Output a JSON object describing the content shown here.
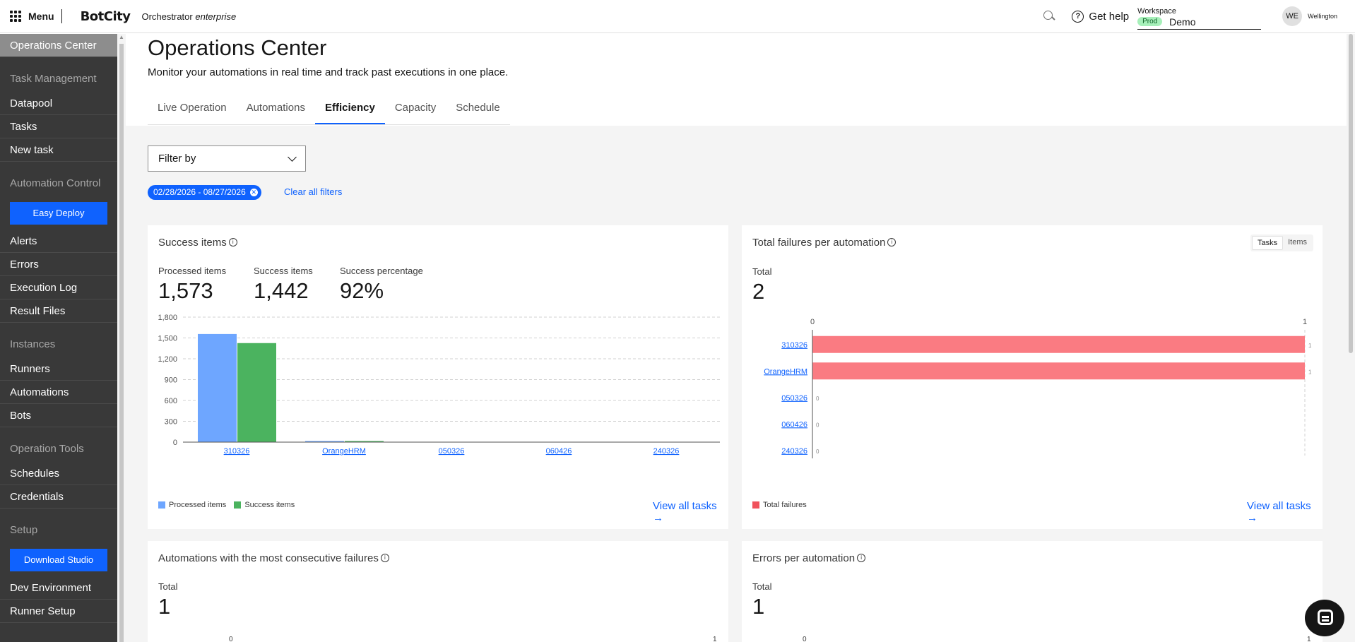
{
  "topbar": {
    "menu_label": "Menu",
    "logo": "BotCity",
    "product_name": "Orchestrator",
    "product_edition": "enterprise",
    "help_label": "Get help",
    "workspace_label": "Workspace",
    "workspace_env": "Prod",
    "workspace_name": "Demo",
    "user_initials": "WE",
    "user_name": "Wellington"
  },
  "sidebar": {
    "active": "Operations Center",
    "groups": [
      {
        "title": "Task Management",
        "items": [
          "Datapool",
          "Tasks",
          "New task"
        ]
      },
      {
        "title": "Automation Control",
        "button": "Easy Deploy",
        "items": [
          "Alerts",
          "Errors",
          "Execution Log",
          "Result Files"
        ]
      },
      {
        "title": "Instances",
        "items": [
          "Runners",
          "Automations",
          "Bots"
        ]
      },
      {
        "title": "Operation Tools",
        "items": [
          "Schedules",
          "Credentials"
        ]
      },
      {
        "title": "Setup",
        "button": "Download Studio",
        "items": [
          "Dev Environment",
          "Runner Setup"
        ]
      }
    ]
  },
  "page": {
    "title": "Operations Center",
    "description": "Monitor your automations in real time and track past executions in one place.",
    "tabs": [
      "Live Operation",
      "Automations",
      "Efficiency",
      "Capacity",
      "Schedule"
    ],
    "active_tab": "Efficiency",
    "filter_label": "Filter by",
    "date_tag": "02/28/2026 - 08/27/2026",
    "clear_filters": "Clear all filters"
  },
  "colors": {
    "accent": "#0f62fe",
    "processed": "#6ea6ff",
    "success": "#4bb35f",
    "failure": "#fa7b82"
  },
  "cards": {
    "success_items": {
      "title": "Success items",
      "metrics": [
        {
          "label": "Processed items",
          "value": "1,573"
        },
        {
          "label": "Success items",
          "value": "1,442"
        },
        {
          "label": "Success percentage",
          "value": "92%"
        }
      ],
      "legend": [
        "Processed items",
        "Success items"
      ],
      "view_all": "View all tasks"
    },
    "total_failures": {
      "title": "Total failures per automation",
      "toggle": [
        "Tasks",
        "Items"
      ],
      "toggle_active": "Tasks",
      "total_label": "Total",
      "total_value": "2",
      "legend": [
        "Total failures"
      ],
      "view_all": "View all tasks"
    },
    "consecutive_failures": {
      "title": "Automations with the most consecutive failures",
      "total_label": "Total",
      "total_value": "1",
      "axis_ticks": [
        "0",
        "1"
      ]
    },
    "errors_per_automation": {
      "title": "Errors per automation",
      "total_label": "Total",
      "total_value": "1",
      "axis_ticks": [
        "0",
        "1"
      ]
    }
  },
  "chart_data": [
    {
      "type": "bar",
      "title": "Success items",
      "categories": [
        "310326",
        "OrangeHRM",
        "050326",
        "060426",
        "240326"
      ],
      "series": [
        {
          "name": "Processed items",
          "values": [
            1557,
            16,
            0,
            0,
            0
          ]
        },
        {
          "name": "Success items",
          "values": [
            1426,
            16,
            0,
            0,
            0
          ]
        }
      ],
      "yticks": [
        "0",
        "300",
        "600",
        "900",
        "1,200",
        "1,500",
        "1,800"
      ],
      "ylim": [
        0,
        1800
      ],
      "grid": true,
      "legend": "bottom-left"
    },
    {
      "type": "bar",
      "orientation": "horizontal",
      "title": "Total failures per automation",
      "categories": [
        "310326",
        "OrangeHRM",
        "050326",
        "060426",
        "240326"
      ],
      "series": [
        {
          "name": "Total failures",
          "values": [
            1,
            1,
            0,
            0,
            0
          ]
        }
      ],
      "xticks": [
        "0",
        "1"
      ],
      "xlim": [
        0,
        1
      ],
      "legend": "bottom-left"
    }
  ]
}
